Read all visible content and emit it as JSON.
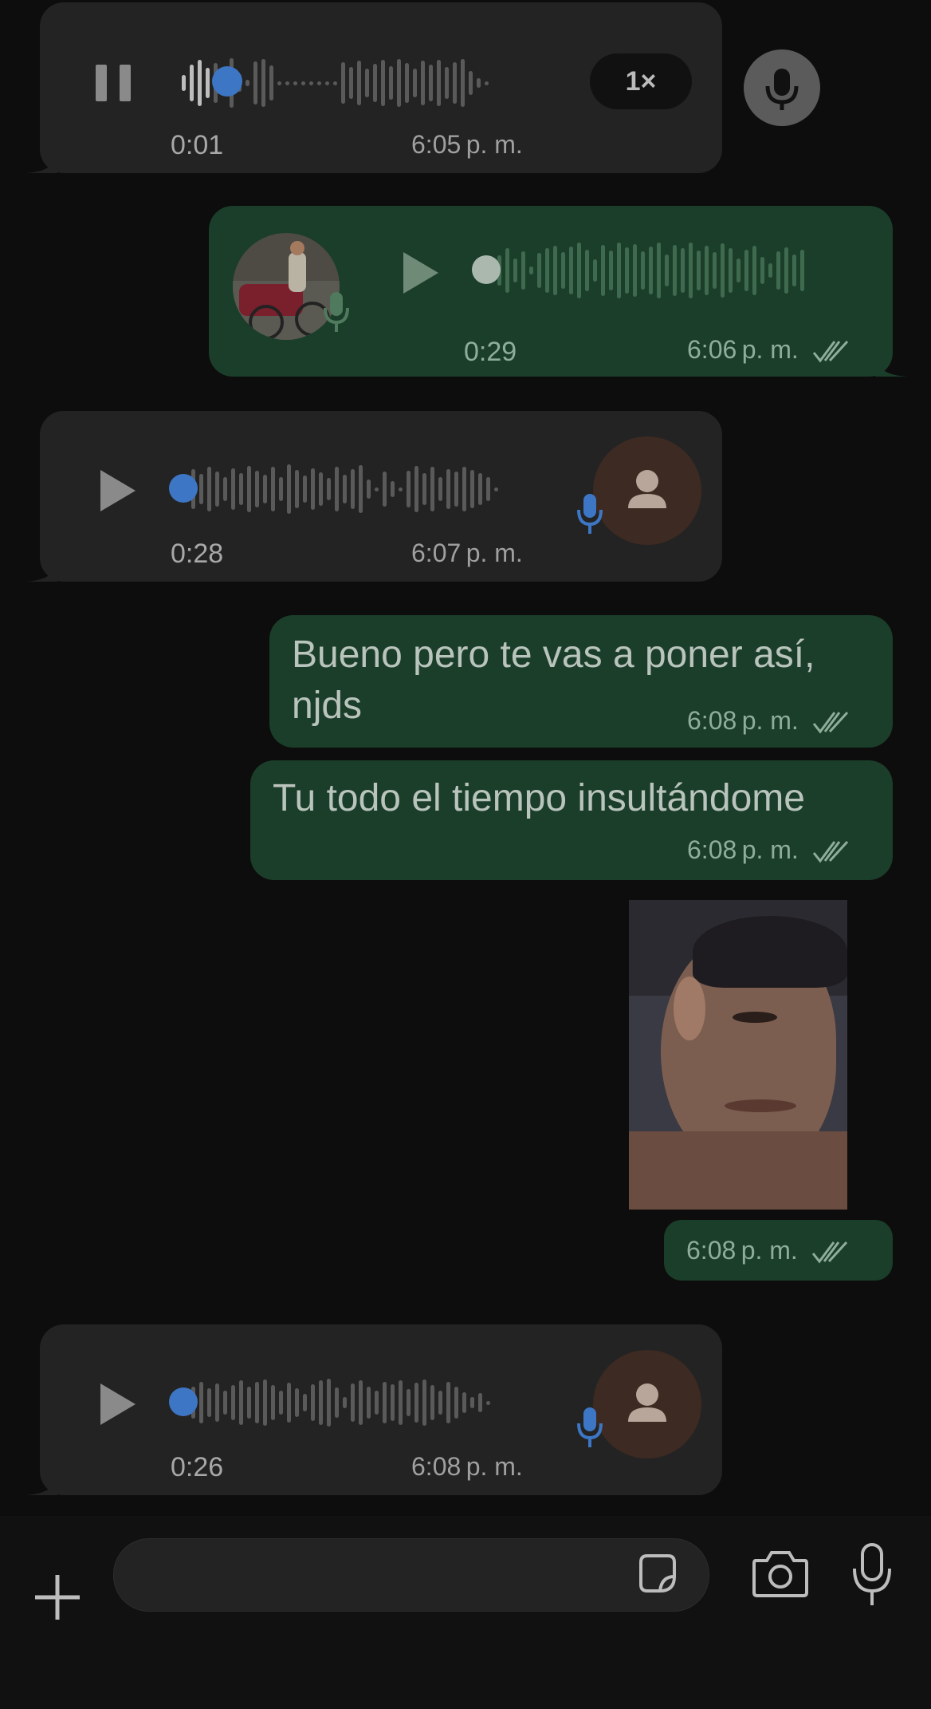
{
  "messages": [
    {
      "type": "voice-in",
      "duration": "0:01",
      "time": "6:05 p. m.",
      "speed": "1×",
      "state": "playing"
    },
    {
      "type": "voice-out",
      "duration": "0:29",
      "time": "6:06 p. m.",
      "state": "paused"
    },
    {
      "type": "voice-in",
      "duration": "0:28",
      "time": "6:07 p. m.",
      "state": "paused"
    },
    {
      "type": "text-out",
      "text": "Bueno pero te vas a poner así, njds",
      "time": "6:08 p. m."
    },
    {
      "type": "text-out",
      "text": "Tu todo el tiempo insultándome",
      "time": "6:08 p. m."
    },
    {
      "type": "sticker-out",
      "time": "6:08 p. m."
    },
    {
      "type": "voice-in",
      "duration": "0:26",
      "time": "6:08 p. m.",
      "state": "paused"
    }
  ],
  "icons": {
    "pause": "pause-icon",
    "play": "play-icon",
    "mic": "microphone-icon",
    "plus": "plus-icon",
    "sticker": "sticker-icon",
    "camera": "camera-icon",
    "read": "double-check-icon"
  },
  "colors": {
    "outgoing": "#1b3e2a",
    "incoming": "#232323",
    "accent": "#3d76c4",
    "avatar": "#3d2a22"
  }
}
